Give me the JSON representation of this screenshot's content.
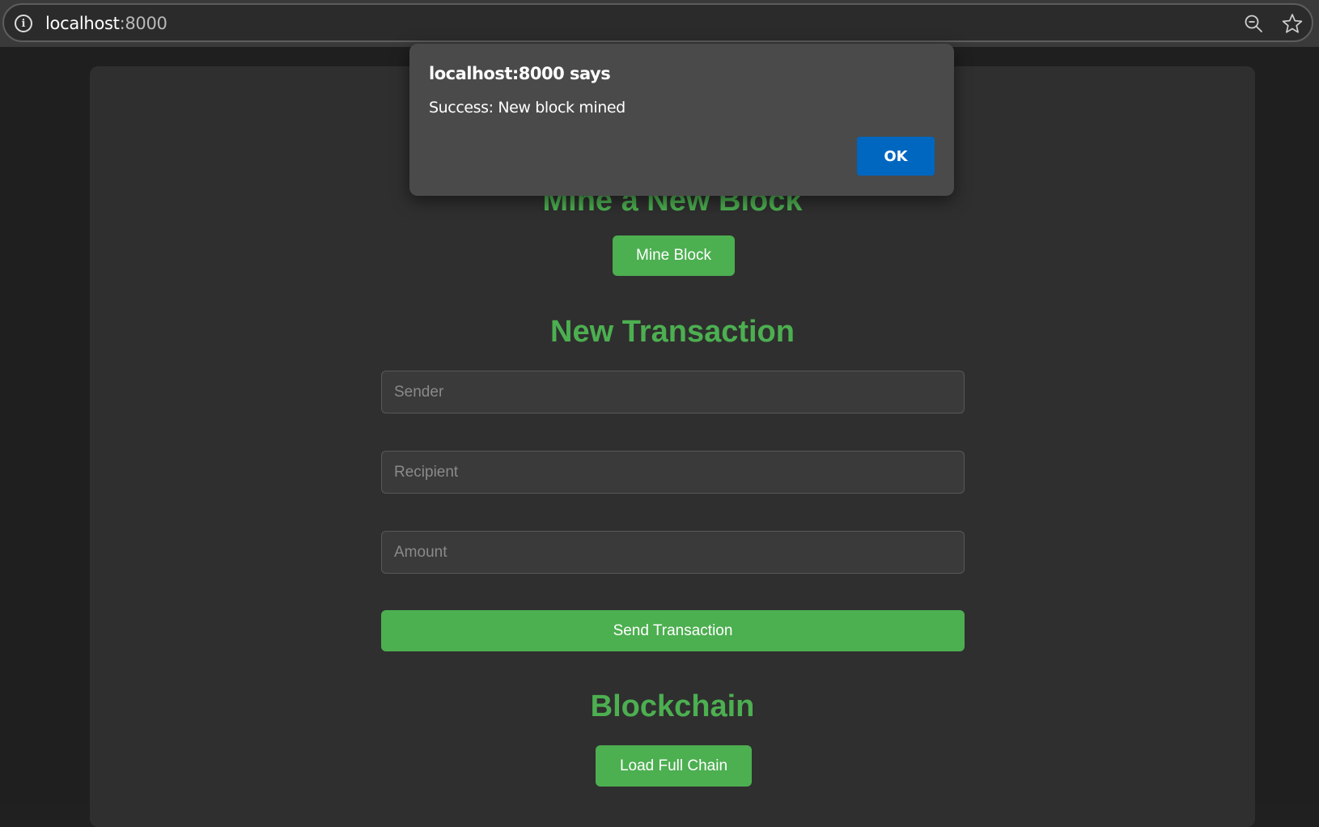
{
  "browser": {
    "url_host": "localhost",
    "url_port": ":8000"
  },
  "dialog": {
    "title": "localhost:8000 says",
    "message": "Success: New block mined",
    "ok_label": "OK",
    "ok_color": "#0067c0"
  },
  "mine": {
    "heading": "Mine a New Block",
    "button_label": "Mine Block"
  },
  "transaction": {
    "heading": "New Transaction",
    "sender_placeholder": "Sender",
    "recipient_placeholder": "Recipient",
    "amount_placeholder": "Amount",
    "send_label": "Send Transaction"
  },
  "blockchain": {
    "heading": "Blockchain",
    "load_label": "Load Full Chain"
  },
  "theme": {
    "accent": "#4caf50",
    "background": "#1f1f1f",
    "card": "#2f2f2f"
  }
}
